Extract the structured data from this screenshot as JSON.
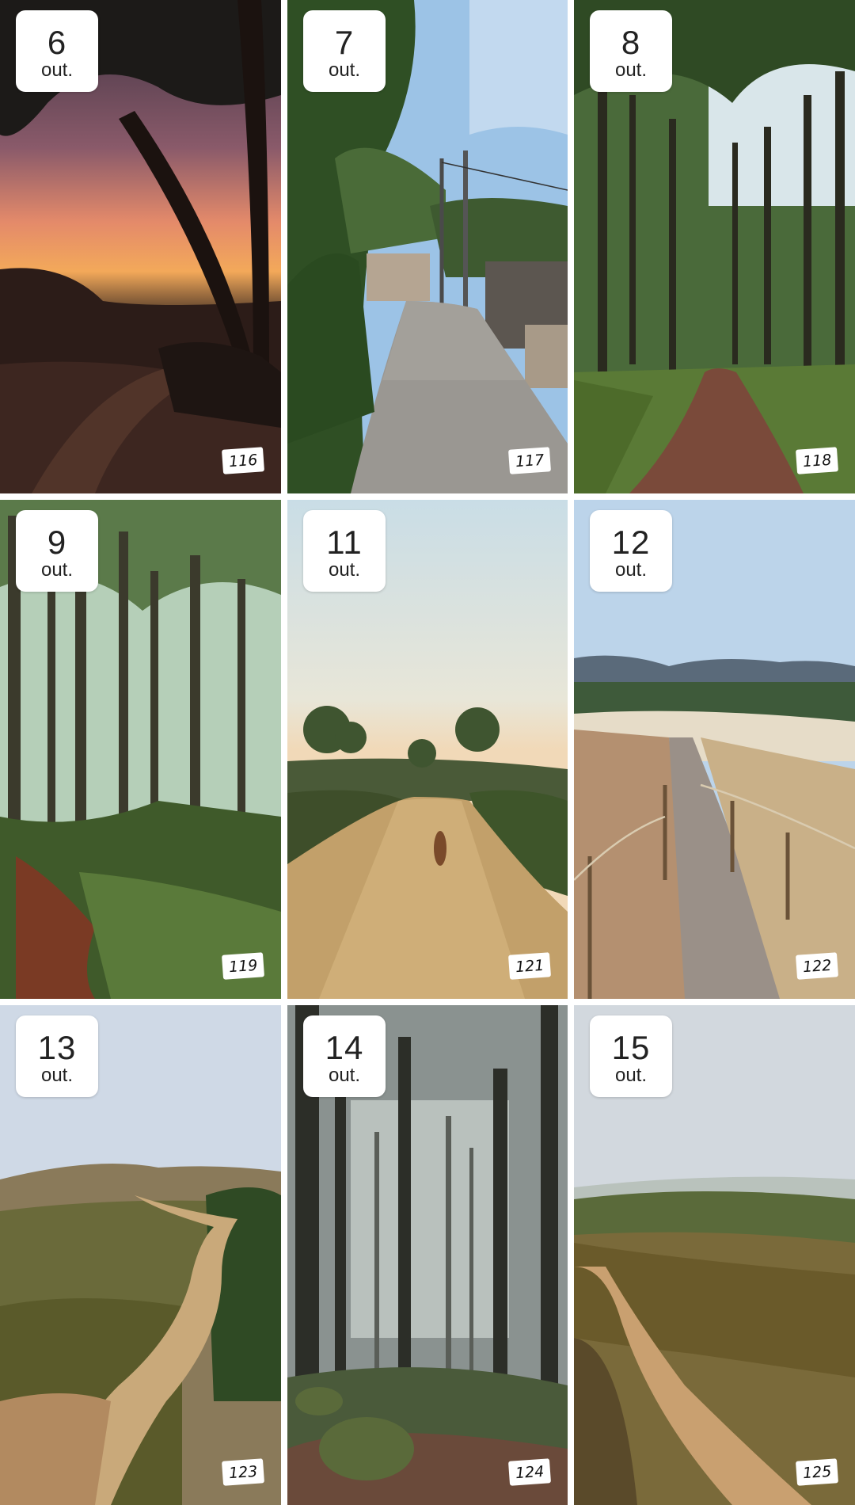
{
  "tiles": [
    {
      "day": "6",
      "month": "out.",
      "number": "116",
      "scene": "sunset-tree-path"
    },
    {
      "day": "7",
      "month": "out.",
      "number": "117",
      "scene": "cobblestone-lane"
    },
    {
      "day": "8",
      "month": "out.",
      "number": "118",
      "scene": "forest-path"
    },
    {
      "day": "9",
      "month": "out.",
      "number": "119",
      "scene": "tall-tree-forest"
    },
    {
      "day": "11",
      "month": "out.",
      "number": "121",
      "scene": "dirt-road-dog"
    },
    {
      "day": "12",
      "month": "out.",
      "number": "122",
      "scene": "dune-boardwalk"
    },
    {
      "day": "13",
      "month": "out.",
      "number": "123",
      "scene": "hillside-trail"
    },
    {
      "day": "14",
      "month": "out.",
      "number": "124",
      "scene": "misty-forest"
    },
    {
      "day": "15",
      "month": "out.",
      "number": "125",
      "scene": "coastal-heath-trail"
    }
  ]
}
